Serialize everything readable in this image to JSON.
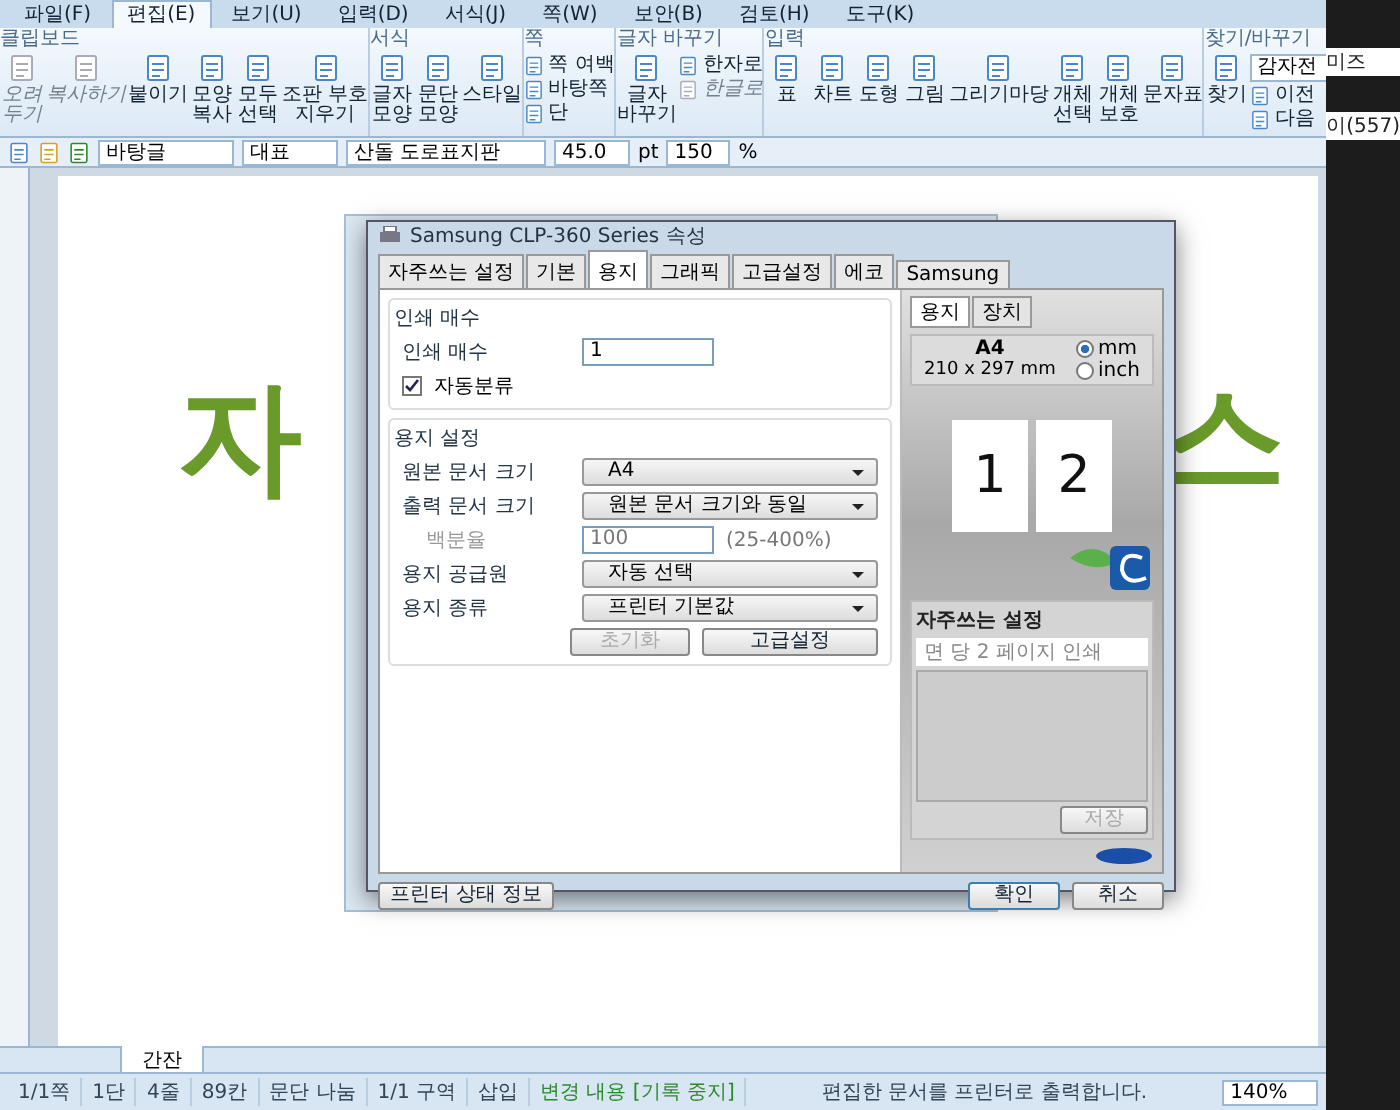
{
  "menu_tabs": [
    {
      "label": "파일(F)",
      "selected": false
    },
    {
      "label": "편집(E)",
      "selected": true
    },
    {
      "label": "보기(U)",
      "selected": false
    },
    {
      "label": "입력(D)",
      "selected": false
    },
    {
      "label": "서식(J)",
      "selected": false
    },
    {
      "label": "쪽(W)",
      "selected": false
    },
    {
      "label": "보안(B)",
      "selected": false
    },
    {
      "label": "검토(H)",
      "selected": false
    },
    {
      "label": "도구(K)",
      "selected": false
    }
  ],
  "ribbon_groups": [
    {
      "title": "클립보드",
      "items": [
        {
          "label": "오려\n두기",
          "kind": "large",
          "disabled": true
        },
        {
          "label": "복사하기",
          "kind": "large",
          "disabled": true
        },
        {
          "label": "붙이기",
          "kind": "large",
          "disabled": false
        },
        {
          "label": "모양\n복사",
          "kind": "large",
          "disabled": false
        },
        {
          "label": "모두\n선택",
          "kind": "large",
          "disabled": false
        },
        {
          "label": "조판 부호\n지우기",
          "kind": "large",
          "disabled": false
        }
      ]
    },
    {
      "title": "서식",
      "items": [
        {
          "label": "글자\n모양",
          "kind": "large",
          "disabled": false
        },
        {
          "label": "문단\n모양",
          "kind": "large",
          "disabled": false
        },
        {
          "label": "스타일",
          "kind": "large",
          "disabled": false
        }
      ]
    },
    {
      "title": "쪽",
      "items": [
        {
          "label": "쪽 여백",
          "kind": "small",
          "disabled": false
        },
        {
          "label": "바탕쪽",
          "kind": "small",
          "disabled": false
        },
        {
          "label": "단",
          "kind": "small",
          "disabled": false
        }
      ]
    },
    {
      "title": "글자 바꾸기",
      "items": [
        {
          "label": "글자\n바꾸기",
          "kind": "large",
          "disabled": false
        },
        {
          "label": "한자로",
          "kind": "small",
          "disabled": false
        },
        {
          "label": "한글로",
          "kind": "small",
          "disabled": true
        }
      ]
    },
    {
      "title": "입력",
      "items": [
        {
          "label": "표",
          "kind": "large",
          "disabled": false
        },
        {
          "label": "차트",
          "kind": "large",
          "disabled": false
        },
        {
          "label": "도형",
          "kind": "large",
          "disabled": false
        },
        {
          "label": "그림",
          "kind": "large",
          "disabled": false
        },
        {
          "label": "그리기마당",
          "kind": "large",
          "disabled": false
        },
        {
          "label": "개체\n선택",
          "kind": "large",
          "disabled": false
        },
        {
          "label": "개체\n보호",
          "kind": "large",
          "disabled": false
        },
        {
          "label": "문자표",
          "kind": "large",
          "disabled": false
        }
      ]
    },
    {
      "title": "찾기/바꾸기",
      "items": [
        {
          "label": "찾기",
          "kind": "large",
          "disabled": false
        },
        {
          "label": "감자전",
          "kind": "field"
        },
        {
          "label": "이전",
          "kind": "small",
          "disabled": false
        },
        {
          "label": "다음",
          "kind": "small",
          "disabled": false
        }
      ]
    }
  ],
  "toolbar": {
    "style": "바탕글",
    "language": "대표",
    "font": "산돌 도로표지판",
    "size": "45.0",
    "unit": "pt",
    "zoom": "150",
    "zoom_unit": "%"
  },
  "document": {
    "left_text": "자",
    "right_text": "스"
  },
  "dialog": {
    "title": "Samsung CLP-360 Series 속성",
    "tabs": [
      {
        "label": "자주쓰는 설정",
        "selected": false
      },
      {
        "label": "기본",
        "selected": false
      },
      {
        "label": "용지",
        "selected": true
      },
      {
        "label": "그래픽",
        "selected": false
      },
      {
        "label": "고급설정",
        "selected": false
      },
      {
        "label": "에코",
        "selected": false
      },
      {
        "label": "Samsung",
        "selected": false
      }
    ],
    "copies_group": {
      "title": "인쇄 매수",
      "label": "인쇄 매수",
      "value": "1",
      "collate": {
        "label": "자동분류",
        "checked": true
      }
    },
    "paper_group": {
      "title": "용지 설정",
      "rows": [
        {
          "label": "원본 문서 크기",
          "kind": "select",
          "value": "A4",
          "disabled": false
        },
        {
          "label": "출력 문서 크기",
          "kind": "select",
          "value": "원본 문서 크기와 동일",
          "disabled": false
        },
        {
          "label": "백분율",
          "kind": "spin",
          "value": "100",
          "note": "(25-400%)",
          "disabled": true
        },
        {
          "label": "용지 공급원",
          "kind": "select",
          "value": "자동 선택",
          "disabled": false
        },
        {
          "label": "용지 종류",
          "kind": "select",
          "value": "프린터 기본값",
          "disabled": false
        }
      ],
      "buttons": [
        {
          "label": "초기화",
          "disabled": true
        },
        {
          "label": "고급설정",
          "disabled": false
        }
      ]
    },
    "preview": {
      "tabs": [
        {
          "label": "용지",
          "selected": true
        },
        {
          "label": "장치",
          "selected": false
        }
      ],
      "size": "A4",
      "dimensions": "210 x 297 mm",
      "units": [
        {
          "label": "mm",
          "selected": true
        },
        {
          "label": "inch",
          "selected": false
        }
      ],
      "pages": [
        "1",
        "2"
      ]
    },
    "favorites": {
      "title": "자주쓰는 설정",
      "placeholder": "면 당 2 페이지 인쇄",
      "save": "저장"
    },
    "footer": {
      "status_button": "프린터 상태 정보",
      "ok": "확인",
      "cancel": "취소"
    }
  },
  "sheet_tab": "간잔",
  "status_bar": [
    "1/1쪽",
    "1단",
    "4줄",
    "89칸",
    "문단 나눔",
    "1/1 구역",
    "삽입",
    "변경 내용 [기록 중지]"
  ],
  "status_message": "편집한 문서를 프린터로 출력합니다.",
  "status_zoom": "140%",
  "background_window": [
    "미즈",
    "이(557)"
  ]
}
